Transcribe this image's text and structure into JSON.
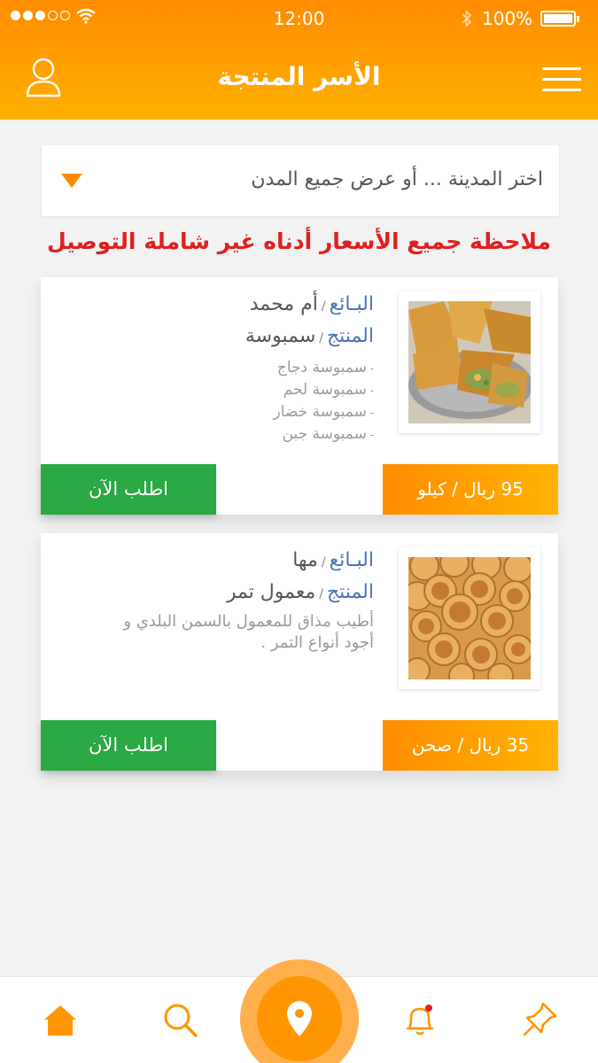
{
  "status_bar": {
    "time": "12:00",
    "battery": "100%"
  },
  "header": {
    "title": "الأسر المنتجة"
  },
  "city_selector": {
    "placeholder": "اختر المدينة ... أو عرض جميع المدن"
  },
  "note": "ملاحظة جميع الأسعار أدناه غير شاملة التوصيل",
  "labels": {
    "seller": "البـائع",
    "product": "المنتج",
    "separator": "/"
  },
  "products": [
    {
      "seller": "أم محمد",
      "product": "سمبوسة",
      "variants": [
        "سمبوسة دجاج",
        "سمبوسة لحم",
        "سمبوسة خضار",
        "سمبوسة جبن"
      ],
      "price": "95 ريال / كيلو",
      "order_label": "اطلب الآن",
      "image": "samosa-image"
    },
    {
      "seller": "مها",
      "product": "معمول تمر",
      "description": [
        "أطيب مذاق للمعمول بالسمن البلدي و",
        "أجود أنواع التمر ."
      ],
      "price": "35 ريال / صحن",
      "order_label": "اطلب الآن",
      "image": "maamoul-image"
    }
  ],
  "bottom_nav": {
    "items": [
      "home-icon",
      "search-icon",
      "location-icon",
      "bell-icon",
      "pin-icon"
    ],
    "accent": "#ff9500"
  },
  "colors": {
    "header_start": "#ff8c00",
    "header_end": "#ffb000",
    "label_blue": "#4a74b8",
    "note_red": "#e02020",
    "order_green": "#2aa843"
  }
}
